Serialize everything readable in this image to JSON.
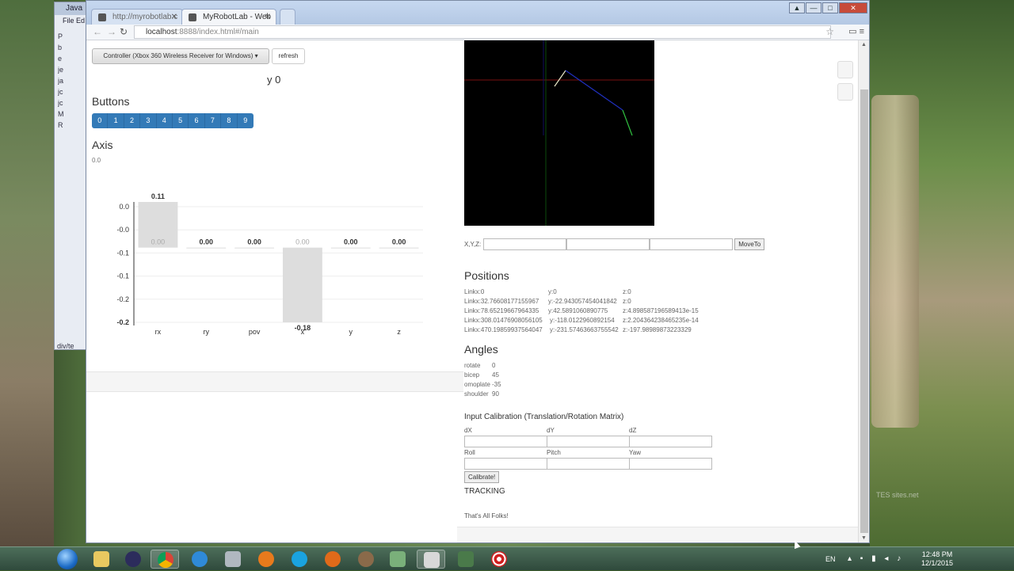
{
  "eclipse": {
    "title": "Java",
    "menu": [
      "File",
      "Ed"
    ],
    "tree": [
      "P",
      "b",
      "e",
      "je",
      "ja",
      "jc",
      "jc",
      "M",
      "R"
    ],
    "status": "div/te"
  },
  "browser": {
    "tabs": [
      {
        "label": "http://myrobotlab.c"
      },
      {
        "label": "MyRobotLab - Web"
      }
    ],
    "url_host": "localhost",
    "url_path": ":8888/index.html#/main",
    "window_buttons": [
      "▲",
      "—",
      "□",
      "✕"
    ]
  },
  "controller": {
    "selector_label": "Controller (Xbox 360 Wireless Receiver for Windows) ▾",
    "refresh_label": "refresh",
    "y_value": "y 0",
    "buttons_heading": "Buttons",
    "buttons": [
      "0",
      "1",
      "2",
      "3",
      "4",
      "5",
      "6",
      "7",
      "8",
      "9"
    ],
    "axis_heading": "Axis",
    "axis_value": "0.0"
  },
  "chart_data": {
    "type": "bar",
    "categories": [
      "rx",
      "ry",
      "pov",
      "x",
      "y",
      "z"
    ],
    "values": [
      0.11,
      0.0,
      0.0,
      -0.18,
      0.0,
      0.0
    ],
    "data_labels": [
      "0.11",
      "0.00",
      "0.00",
      "-0.18",
      "0.00",
      "0.00"
    ],
    "inner_labels": [
      "0.00",
      "",
      "",
      "0.00",
      "",
      ""
    ],
    "ytick_labels": [
      "0.0",
      "-0.0",
      "-0.1",
      "-0.1",
      "-0.2",
      "-0.2"
    ],
    "ylim": [
      -0.18,
      0.11
    ],
    "bar_color": "#dddddd"
  },
  "kinematics": {
    "xyz_label": "X,Y,Z:",
    "move_label": "MoveTo",
    "positions_heading": "Positions",
    "positions": [
      [
        "Linkx:0",
        "y:0",
        "z:0"
      ],
      [
        "Linkx:32.76608177155967",
        "y:-22.943057454041842",
        "z:0"
      ],
      [
        "Linkx:78.65219667964335",
        "y:42.5891060890775",
        "z:4.898587196589413e-15"
      ],
      [
        "Linkx:308.01476908056105",
        "y:-118.0122960892154",
        "z:2.204364238465235e-14"
      ],
      [
        "Linkx:470.19859937564047",
        "y:-231.57463663755542",
        "z:-197.98989873223329"
      ]
    ],
    "angles_heading": "Angles",
    "angles": [
      [
        "rotate",
        "0"
      ],
      [
        "bicep",
        "45"
      ],
      [
        "omoplate",
        "-35"
      ],
      [
        "shoulder",
        "90"
      ]
    ],
    "calibration_heading": "Input Calibration (Translation/Rotation Matrix)",
    "calibration_labels": [
      "dX",
      "dY",
      "dZ",
      "Roll",
      "Pitch",
      "Yaw"
    ],
    "calibrate_label": "Calibrate!",
    "tracking_label": "TRACKING",
    "footer_text": "That's All Folks!"
  },
  "taskbar": {
    "language": "EN",
    "time": "12:48 PM",
    "date": "12/1/2015"
  },
  "desktop": {
    "watermark": "TES\nsites.net"
  }
}
